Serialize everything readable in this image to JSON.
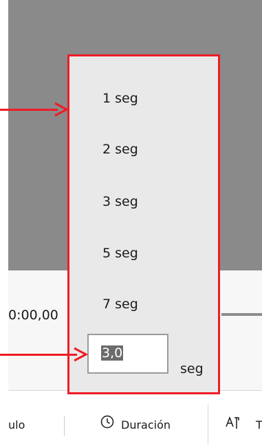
{
  "timeline": {
    "time_readout": "0:00,00"
  },
  "toolbar": {
    "left_label_partial": "ulo",
    "duration_label": "Duración",
    "text_label_partial": "T"
  },
  "duration_menu": {
    "options": [
      "1 seg",
      "2 seg",
      "3 seg",
      "5 seg",
      "7 seg"
    ],
    "custom_value": "3,0",
    "custom_unit": "seg"
  },
  "annotations": {
    "color": "#ee1c24"
  },
  "icons": {
    "duration": "clock-icon",
    "text": "text-icon"
  }
}
